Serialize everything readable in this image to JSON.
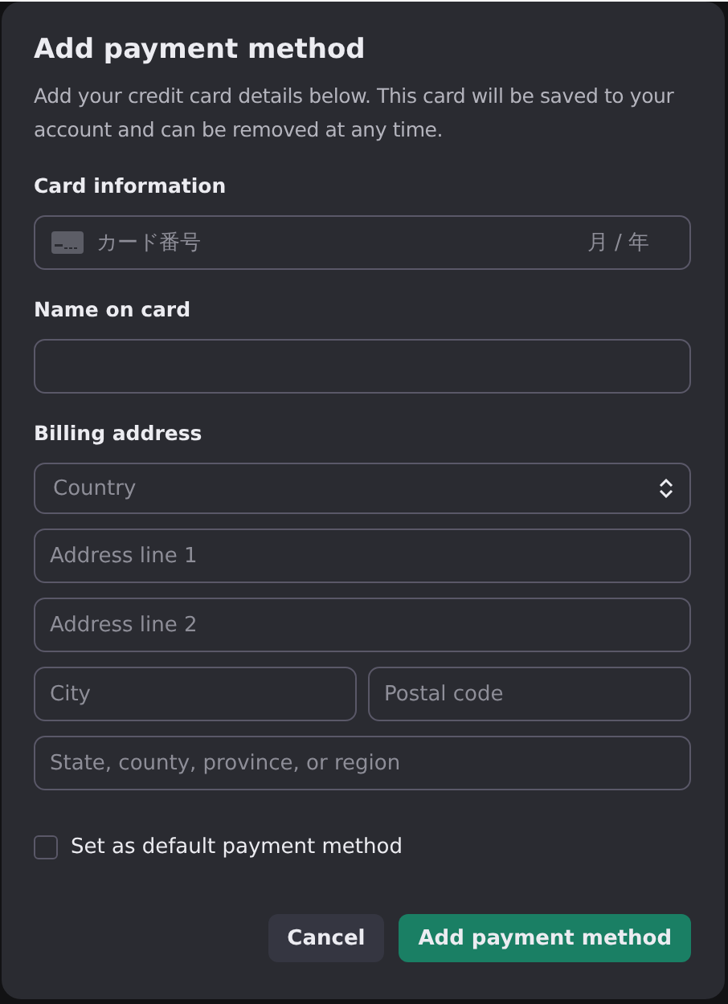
{
  "dialog": {
    "title": "Add payment method",
    "description": "Add your credit card details below. This card will be saved to your account and can be removed at any time."
  },
  "card_information": {
    "label": "Card information",
    "number_placeholder": "カード番号",
    "expiry_placeholder": "月 / 年"
  },
  "name_on_card": {
    "label": "Name on card"
  },
  "billing_address": {
    "label": "Billing address",
    "country": {
      "placeholder": "Country"
    },
    "rows": [
      {
        "fields": [
          {
            "placeholder": "Address line 1"
          }
        ]
      },
      {
        "fields": [
          {
            "placeholder": "Address line 2"
          }
        ]
      },
      {
        "fields": [
          {
            "placeholder": "City"
          },
          {
            "placeholder": "Postal code"
          }
        ]
      },
      {
        "fields": [
          {
            "placeholder": "State, county, province, or region"
          }
        ]
      }
    ]
  },
  "default_checkbox": {
    "label": "Set as default payment method",
    "checked": false
  },
  "buttons": [
    {
      "label": "Cancel",
      "kind": "secondary"
    },
    {
      "label": "Add payment method",
      "kind": "primary"
    }
  ]
}
